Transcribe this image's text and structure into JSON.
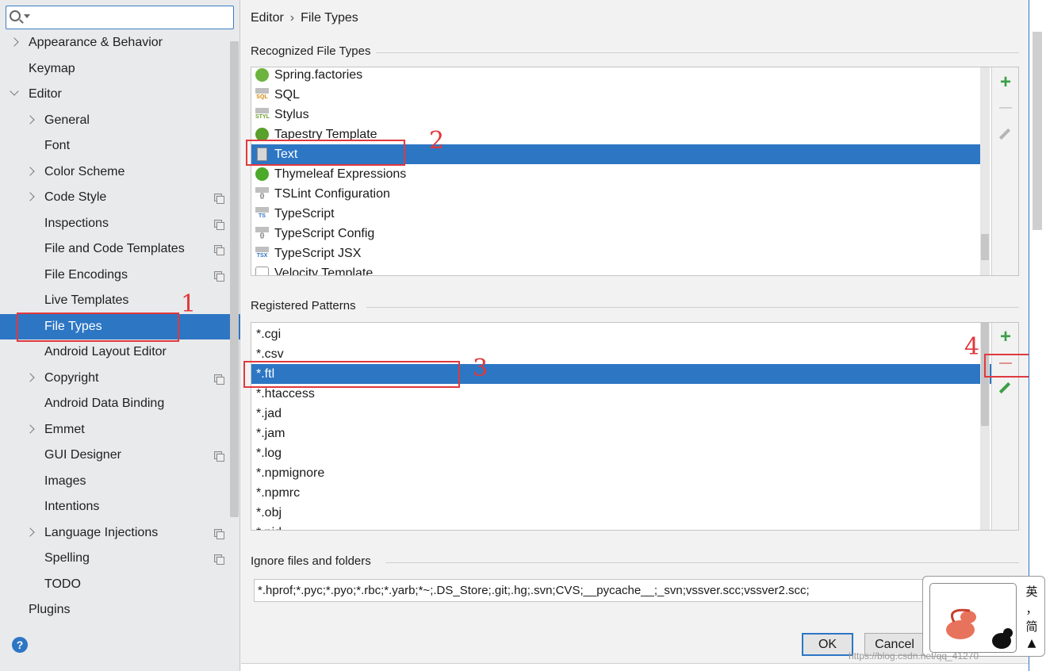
{
  "search": {
    "placeholder": ""
  },
  "sidebar": {
    "items": [
      {
        "label": "Appearance & Behavior",
        "level": 0,
        "arrow": "right"
      },
      {
        "label": "Keymap",
        "level": 0
      },
      {
        "label": "Editor",
        "level": 0,
        "arrow": "down"
      },
      {
        "label": "General",
        "level": 1,
        "arrow": "right"
      },
      {
        "label": "Font",
        "level": 1
      },
      {
        "label": "Color Scheme",
        "level": 1,
        "arrow": "right"
      },
      {
        "label": "Code Style",
        "level": 1,
        "arrow": "right",
        "project": true
      },
      {
        "label": "Inspections",
        "level": 1,
        "project": true
      },
      {
        "label": "File and Code Templates",
        "level": 1,
        "project": true
      },
      {
        "label": "File Encodings",
        "level": 1,
        "project": true
      },
      {
        "label": "Live Templates",
        "level": 1
      },
      {
        "label": "File Types",
        "level": 1,
        "selected": true
      },
      {
        "label": "Android Layout Editor",
        "level": 1
      },
      {
        "label": "Copyright",
        "level": 1,
        "arrow": "right",
        "project": true
      },
      {
        "label": "Android Data Binding",
        "level": 1
      },
      {
        "label": "Emmet",
        "level": 1,
        "arrow": "right"
      },
      {
        "label": "GUI Designer",
        "level": 1,
        "project": true
      },
      {
        "label": "Images",
        "level": 1
      },
      {
        "label": "Intentions",
        "level": 1
      },
      {
        "label": "Language Injections",
        "level": 1,
        "arrow": "right",
        "project": true
      },
      {
        "label": "Spelling",
        "level": 1,
        "project": true
      },
      {
        "label": "TODO",
        "level": 1
      },
      {
        "label": "Plugins",
        "level": 0
      }
    ],
    "help_label": "?"
  },
  "breadcrumb": {
    "parent": "Editor",
    "separator": "›",
    "current": "File Types"
  },
  "recognized": {
    "title": "Recognized File Types",
    "items": [
      {
        "name": "Spring.factories",
        "icon": "spring-leaf-icon",
        "color": "#6db33f"
      },
      {
        "name": "SQL",
        "icon": "sql-icon",
        "badge": "SQL",
        "color": "#d4870c"
      },
      {
        "name": "Stylus",
        "icon": "stylus-icon",
        "badge": "STYL",
        "color": "#6aa02b"
      },
      {
        "name": "Tapestry Template",
        "icon": "tapestry-icon",
        "color": "#5aa02c"
      },
      {
        "name": "Text",
        "icon": "text-file-icon",
        "selected": true
      },
      {
        "name": "Thymeleaf Expressions",
        "icon": "thymeleaf-icon",
        "color": "#4caa2a"
      },
      {
        "name": "TSLint Configuration",
        "icon": "json-config-icon",
        "badge": "{}"
      },
      {
        "name": "TypeScript",
        "icon": "typescript-icon",
        "badge": "TS",
        "color": "#2f74c0"
      },
      {
        "name": "TypeScript Config",
        "icon": "json-config-icon",
        "badge": "{}"
      },
      {
        "name": "TypeScript JSX",
        "icon": "tsx-icon",
        "badge": "TSX",
        "color": "#2f74c0"
      },
      {
        "name": "Velocity Template",
        "icon": "velocity-icon"
      }
    ]
  },
  "patterns": {
    "title": "Registered Patterns",
    "items": [
      {
        "name": "*.cgi"
      },
      {
        "name": "*.csv"
      },
      {
        "name": "*.ftl",
        "selected": true
      },
      {
        "name": "*.htaccess"
      },
      {
        "name": "*.jad"
      },
      {
        "name": "*.jam"
      },
      {
        "name": "*.log"
      },
      {
        "name": "*.npmignore"
      },
      {
        "name": "*.npmrc"
      },
      {
        "name": "*.obj"
      },
      {
        "name": "*.pid"
      }
    ]
  },
  "ignore": {
    "title": "Ignore files and folders",
    "value": "*.hprof;*.pyc;*.pyo;*.rbc;*.yarb;*~;.DS_Store;.git;.hg;.svn;CVS;__pycache__;_svn;vssver.scc;vssver2.scc;"
  },
  "buttons": {
    "ok": "OK",
    "cancel": "Cancel"
  },
  "toolbar": {
    "add": "+",
    "remove": "—"
  },
  "annotations": [
    "1",
    "2",
    "3",
    "4"
  ],
  "ime": {
    "chars": [
      "英",
      "，",
      "简"
    ]
  },
  "watermark": "https://blog.csdn.net/qq_41270"
}
